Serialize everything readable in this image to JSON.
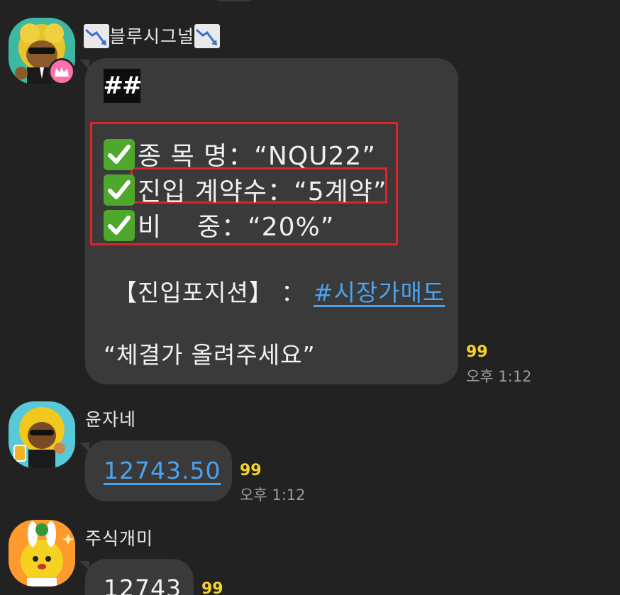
{
  "colors": {
    "background": "#222222",
    "bubble": "#3a3a3a",
    "text": "#f2f2f2",
    "link": "#4ba3f0",
    "read_count": "#f5d42a",
    "highlight_box": "#e0232b",
    "check": "#4ea82c"
  },
  "messages": [
    {
      "sender": "블루시그널",
      "sender_icon": "chart-down-icon",
      "badge_icon": "crown-icon",
      "header": "##",
      "lines": [
        {
          "icon": "check-icon",
          "label": "종 목  명",
          "sep": "：",
          "value": "“NQU22”"
        },
        {
          "icon": "check-icon",
          "label": "진입 계약수",
          "sep": "：",
          "value": "“5계약”"
        },
        {
          "icon": "check-icon",
          "label": "비    중",
          "sep": "：",
          "value": "“20%”"
        }
      ],
      "position_label": "【진입포지션】",
      "position_sep": "：",
      "position_link": "#시장가매도",
      "request": "“체결가 올려주세요”",
      "read_count": "99",
      "time": "오후 1:12"
    },
    {
      "sender": "윤자네",
      "text": "12743.50",
      "read_count": "99",
      "time": "오후 1:12"
    },
    {
      "sender": "주식개미",
      "text": "12743",
      "read_count": "99"
    }
  ]
}
